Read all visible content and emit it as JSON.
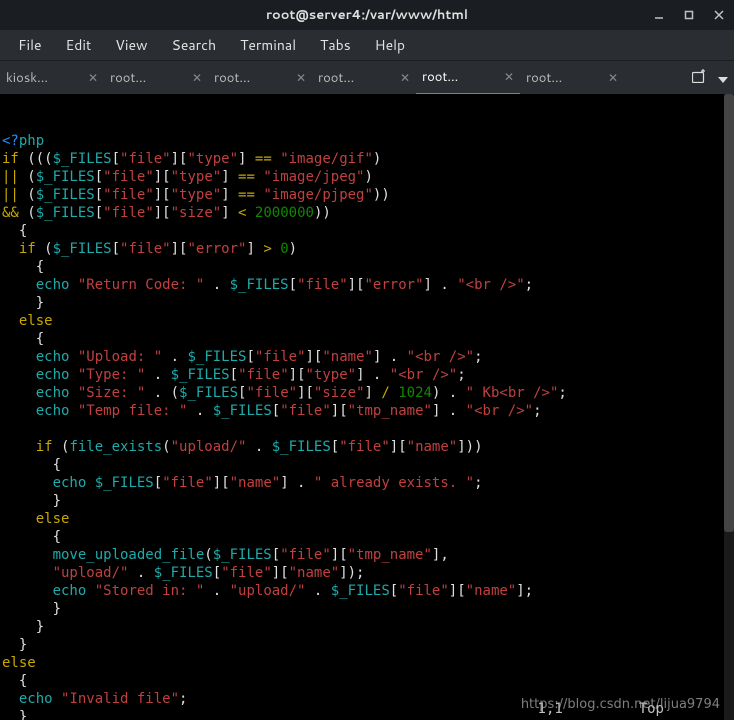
{
  "window": {
    "title": "root@server4:/var/www/html"
  },
  "menu": {
    "items": [
      "File",
      "Edit",
      "View",
      "Search",
      "Terminal",
      "Tabs",
      "Help"
    ]
  },
  "tabs": {
    "list": [
      {
        "label": "kiosk...",
        "active": false
      },
      {
        "label": "root...",
        "active": false
      },
      {
        "label": "root...",
        "active": false
      },
      {
        "label": "root...",
        "active": false
      },
      {
        "label": "root...",
        "active": true
      },
      {
        "label": "root...",
        "active": false
      }
    ]
  },
  "code": {
    "lines": [
      [
        [
          "p",
          "<?"
        ],
        [
          "c",
          "php"
        ]
      ],
      [
        [
          "y",
          "if"
        ],
        [
          "w",
          " ((("
        ],
        [
          "c",
          "$_FILES"
        ],
        [
          "w",
          "["
        ],
        [
          "r",
          "\"file\""
        ],
        [
          "w",
          "]["
        ],
        [
          "r",
          "\"type\""
        ],
        [
          "w",
          "] "
        ],
        [
          "y",
          "=="
        ],
        [
          "w",
          " "
        ],
        [
          "r",
          "\"image/gif\""
        ],
        [
          "w",
          ")"
        ]
      ],
      [
        [
          "y",
          "||"
        ],
        [
          "w",
          " ("
        ],
        [
          "c",
          "$_FILES"
        ],
        [
          "w",
          "["
        ],
        [
          "r",
          "\"file\""
        ],
        [
          "w",
          "]["
        ],
        [
          "r",
          "\"type\""
        ],
        [
          "w",
          "] "
        ],
        [
          "y",
          "=="
        ],
        [
          "w",
          " "
        ],
        [
          "r",
          "\"image/jpeg\""
        ],
        [
          "w",
          ")"
        ]
      ],
      [
        [
          "y",
          "||"
        ],
        [
          "w",
          " ("
        ],
        [
          "c",
          "$_FILES"
        ],
        [
          "w",
          "["
        ],
        [
          "r",
          "\"file\""
        ],
        [
          "w",
          "]["
        ],
        [
          "r",
          "\"type\""
        ],
        [
          "w",
          "] "
        ],
        [
          "y",
          "=="
        ],
        [
          "w",
          " "
        ],
        [
          "r",
          "\"image/pjpeg\""
        ],
        [
          "w",
          "))"
        ]
      ],
      [
        [
          "y",
          "&&"
        ],
        [
          "w",
          " ("
        ],
        [
          "c",
          "$_FILES"
        ],
        [
          "w",
          "["
        ],
        [
          "r",
          "\"file\""
        ],
        [
          "w",
          "]["
        ],
        [
          "r",
          "\"size\""
        ],
        [
          "w",
          "] "
        ],
        [
          "y",
          "<"
        ],
        [
          "w",
          " "
        ],
        [
          "g",
          "2000000"
        ],
        [
          "w",
          "))"
        ]
      ],
      [
        [
          "w",
          "  {"
        ]
      ],
      [
        [
          "w",
          "  "
        ],
        [
          "y",
          "if"
        ],
        [
          "w",
          " ("
        ],
        [
          "c",
          "$_FILES"
        ],
        [
          "w",
          "["
        ],
        [
          "r",
          "\"file\""
        ],
        [
          "w",
          "]["
        ],
        [
          "r",
          "\"error\""
        ],
        [
          "w",
          "] "
        ],
        [
          "y",
          ">"
        ],
        [
          "w",
          " "
        ],
        [
          "g",
          "0"
        ],
        [
          "w",
          ")"
        ]
      ],
      [
        [
          "w",
          "    {"
        ]
      ],
      [
        [
          "w",
          "    "
        ],
        [
          "c",
          "echo"
        ],
        [
          "w",
          " "
        ],
        [
          "r",
          "\"Return Code: \""
        ],
        [
          "w",
          " . "
        ],
        [
          "c",
          "$_FILES"
        ],
        [
          "w",
          "["
        ],
        [
          "r",
          "\"file\""
        ],
        [
          "w",
          "]["
        ],
        [
          "r",
          "\"error\""
        ],
        [
          "w",
          "] . "
        ],
        [
          "r",
          "\"<br />\""
        ],
        [
          "w",
          ";"
        ]
      ],
      [
        [
          "w",
          "    }"
        ]
      ],
      [
        [
          "w",
          "  "
        ],
        [
          "y",
          "else"
        ]
      ],
      [
        [
          "w",
          "    {"
        ]
      ],
      [
        [
          "w",
          "    "
        ],
        [
          "c",
          "echo"
        ],
        [
          "w",
          " "
        ],
        [
          "r",
          "\"Upload: \""
        ],
        [
          "w",
          " . "
        ],
        [
          "c",
          "$_FILES"
        ],
        [
          "w",
          "["
        ],
        [
          "r",
          "\"file\""
        ],
        [
          "w",
          "]["
        ],
        [
          "r",
          "\"name\""
        ],
        [
          "w",
          "] . "
        ],
        [
          "r",
          "\"<br />\""
        ],
        [
          "w",
          ";"
        ]
      ],
      [
        [
          "w",
          "    "
        ],
        [
          "c",
          "echo"
        ],
        [
          "w",
          " "
        ],
        [
          "r",
          "\"Type: \""
        ],
        [
          "w",
          " . "
        ],
        [
          "c",
          "$_FILES"
        ],
        [
          "w",
          "["
        ],
        [
          "r",
          "\"file\""
        ],
        [
          "w",
          "]["
        ],
        [
          "r",
          "\"type\""
        ],
        [
          "w",
          "] . "
        ],
        [
          "r",
          "\"<br />\""
        ],
        [
          "w",
          ";"
        ]
      ],
      [
        [
          "w",
          "    "
        ],
        [
          "c",
          "echo"
        ],
        [
          "w",
          " "
        ],
        [
          "r",
          "\"Size: \""
        ],
        [
          "w",
          " . ("
        ],
        [
          "c",
          "$_FILES"
        ],
        [
          "w",
          "["
        ],
        [
          "r",
          "\"file\""
        ],
        [
          "w",
          "]["
        ],
        [
          "r",
          "\"size\""
        ],
        [
          "w",
          "] "
        ],
        [
          "y",
          "/"
        ],
        [
          "w",
          " "
        ],
        [
          "g",
          "1024"
        ],
        [
          "w",
          ") . "
        ],
        [
          "r",
          "\" Kb<br />\""
        ],
        [
          "w",
          ";"
        ]
      ],
      [
        [
          "w",
          "    "
        ],
        [
          "c",
          "echo"
        ],
        [
          "w",
          " "
        ],
        [
          "r",
          "\"Temp file: \""
        ],
        [
          "w",
          " . "
        ],
        [
          "c",
          "$_FILES"
        ],
        [
          "w",
          "["
        ],
        [
          "r",
          "\"file\""
        ],
        [
          "w",
          "]["
        ],
        [
          "r",
          "\"tmp_name\""
        ],
        [
          "w",
          "] . "
        ],
        [
          "r",
          "\"<br />\""
        ],
        [
          "w",
          ";"
        ]
      ],
      [
        [
          "w",
          " "
        ]
      ],
      [
        [
          "w",
          "    "
        ],
        [
          "y",
          "if"
        ],
        [
          "w",
          " ("
        ],
        [
          "c",
          "file_exists"
        ],
        [
          "w",
          "("
        ],
        [
          "r",
          "\"upload/\""
        ],
        [
          "w",
          " . "
        ],
        [
          "c",
          "$_FILES"
        ],
        [
          "w",
          "["
        ],
        [
          "r",
          "\"file\""
        ],
        [
          "w",
          "]["
        ],
        [
          "r",
          "\"name\""
        ],
        [
          "w",
          "]))"
        ]
      ],
      [
        [
          "w",
          "      {"
        ]
      ],
      [
        [
          "w",
          "      "
        ],
        [
          "c",
          "echo"
        ],
        [
          "w",
          " "
        ],
        [
          "c",
          "$_FILES"
        ],
        [
          "w",
          "["
        ],
        [
          "r",
          "\"file\""
        ],
        [
          "w",
          "]["
        ],
        [
          "r",
          "\"name\""
        ],
        [
          "w",
          "] . "
        ],
        [
          "r",
          "\" already exists. \""
        ],
        [
          "w",
          ";"
        ]
      ],
      [
        [
          "w",
          "      }"
        ]
      ],
      [
        [
          "w",
          "    "
        ],
        [
          "y",
          "else"
        ]
      ],
      [
        [
          "w",
          "      {"
        ]
      ],
      [
        [
          "w",
          "      "
        ],
        [
          "c",
          "move_uploaded_file"
        ],
        [
          "w",
          "("
        ],
        [
          "c",
          "$_FILES"
        ],
        [
          "w",
          "["
        ],
        [
          "r",
          "\"file\""
        ],
        [
          "w",
          "]["
        ],
        [
          "r",
          "\"tmp_name\""
        ],
        [
          "w",
          "],"
        ]
      ],
      [
        [
          "w",
          "      "
        ],
        [
          "r",
          "\"upload/\""
        ],
        [
          "w",
          " . "
        ],
        [
          "c",
          "$_FILES"
        ],
        [
          "w",
          "["
        ],
        [
          "r",
          "\"file\""
        ],
        [
          "w",
          "]["
        ],
        [
          "r",
          "\"name\""
        ],
        [
          "w",
          "]);"
        ]
      ],
      [
        [
          "w",
          "      "
        ],
        [
          "c",
          "echo"
        ],
        [
          "w",
          " "
        ],
        [
          "r",
          "\"Stored in: \""
        ],
        [
          "w",
          " . "
        ],
        [
          "r",
          "\"upload/\""
        ],
        [
          "w",
          " . "
        ],
        [
          "c",
          "$_FILES"
        ],
        [
          "w",
          "["
        ],
        [
          "r",
          "\"file\""
        ],
        [
          "w",
          "]["
        ],
        [
          "r",
          "\"name\""
        ],
        [
          "w",
          "];"
        ]
      ],
      [
        [
          "w",
          "      }"
        ]
      ],
      [
        [
          "w",
          "    }"
        ]
      ],
      [
        [
          "w",
          "  }"
        ]
      ],
      [
        [
          "y",
          "else"
        ]
      ],
      [
        [
          "w",
          "  {"
        ]
      ],
      [
        [
          "w",
          "  "
        ],
        [
          "c",
          "echo"
        ],
        [
          "w",
          " "
        ],
        [
          "r",
          "\"Invalid file\""
        ],
        [
          "w",
          ";"
        ]
      ],
      [
        [
          "w",
          "  }"
        ]
      ]
    ]
  },
  "status": {
    "pos": "1,1",
    "loc": "Top"
  },
  "watermark": "https://blog.csdn.net/lijua9794"
}
